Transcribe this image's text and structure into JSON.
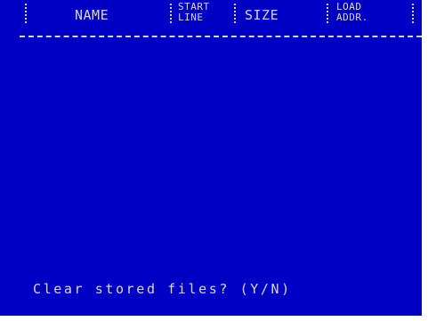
{
  "colors": {
    "screen_background": "#0000c4",
    "text": "#d8d8d8",
    "border": "#ffffff"
  },
  "header": {
    "name_label": "NAME",
    "start_line_label": [
      "START",
      "LINE"
    ],
    "size_label": "SIZE",
    "load_addr_label": [
      "LOAD",
      "ADDR."
    ]
  },
  "prompt": {
    "text": "Clear stored files? (Y/N)"
  }
}
